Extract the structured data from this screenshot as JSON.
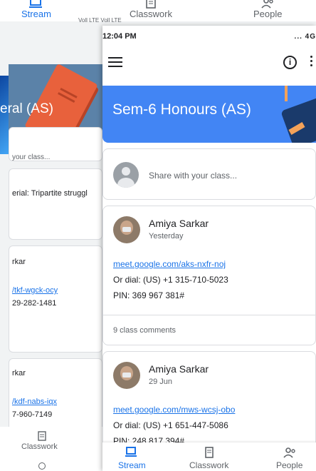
{
  "background": {
    "top_nav": {
      "stream": "Stream",
      "classwork": "Classwork",
      "people": "People"
    },
    "status_icons": "Voll LTE Voll LTE",
    "banner_title": "eral (AS)",
    "share_partial": "your class...",
    "post_title_partial": "erial: Tripartite struggl",
    "author_1": "rkar",
    "link_1": "/tkf-wgck-ocy",
    "phone_1": "29-282-1481",
    "author_2": "rkar",
    "link_2": "/kdf-nabs-iqx",
    "phone_2": "7-960-7149",
    "bottom_nav_classwork": "Classwork"
  },
  "status_bar": {
    "time": "12:04 PM",
    "icons": "... 4G"
  },
  "class": {
    "name": "Sem-6 Honours (AS)"
  },
  "share": {
    "placeholder": "Share with your class..."
  },
  "posts": [
    {
      "author": "Amiya Sarkar",
      "date": "Yesterday",
      "link": "meet.google.com/aks-nxfr-noj",
      "dial": "Or dial: (US) +1 315-710-5023",
      "pin": "PIN: 369 967 381#",
      "comments": "9 class comments"
    },
    {
      "author": "Amiya Sarkar",
      "date": "29 Jun",
      "link": "meet.google.com/mws-wcsj-obo",
      "dial": "Or dial: (US) +1 651-447-5086",
      "pin": "PIN: 248 817 394#"
    }
  ],
  "bottom_nav": {
    "stream": "Stream",
    "classwork": "Classwork",
    "people": "People"
  },
  "colors": {
    "accent": "#1a73e8",
    "banner": "#4285f4"
  }
}
